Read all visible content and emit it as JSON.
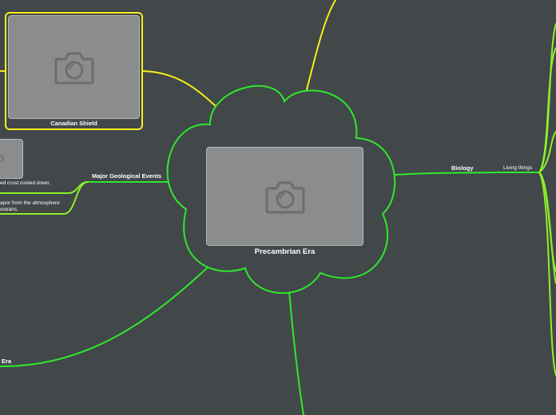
{
  "colors": {
    "background": "#42474a",
    "branch_green": "#2ee82b",
    "branch_yellow": "#f2f018",
    "branch_lime": "#8cf02a",
    "image_placeholder": "#8a8c8d",
    "text": "#ffffff"
  },
  "central": {
    "title": "Precambrian Era",
    "image_icon": "camera-icon"
  },
  "topics": {
    "canadian_shield": {
      "label": "Canadian Shield",
      "image_icon": "camera-icon"
    },
    "major_geological_events": {
      "label": "Major Geological Events",
      "subtopics": [
        "ed crust cooled down,",
        "apor from the atmosphere",
        "oceans."
      ]
    },
    "biology": {
      "label": "Biology",
      "subtopic": "Living things"
    },
    "bottom_left": {
      "label": "Era"
    }
  }
}
